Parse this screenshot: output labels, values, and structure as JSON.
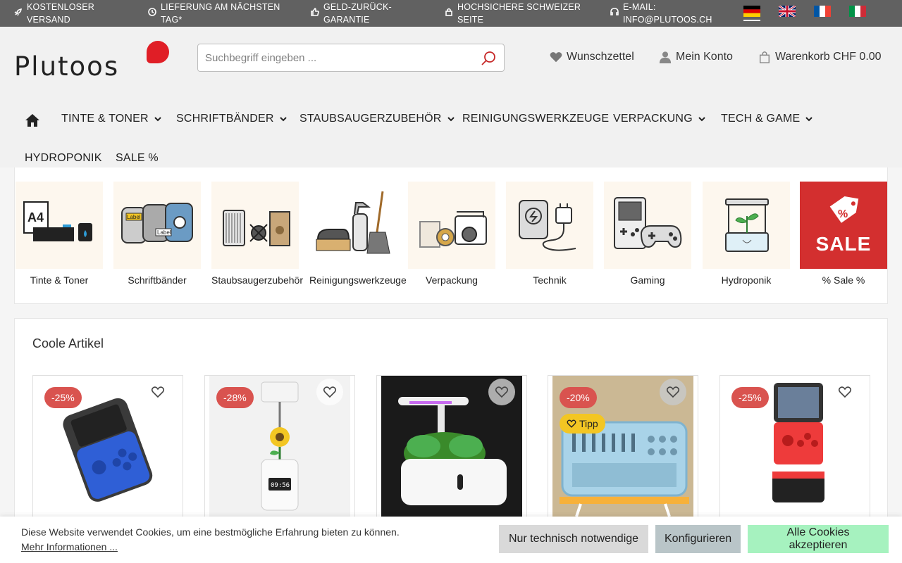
{
  "topbar": {
    "items": [
      {
        "icon": "rocket-icon",
        "line1": "KOSTENLOSER",
        "line2": "VERSAND"
      },
      {
        "icon": "clock-icon",
        "line1": "LIEFERUNG AM NÄCHSTEN",
        "line2": "TAG*"
      },
      {
        "icon": "thumbs-up-icon",
        "line1": "GELD-ZURÜCK-",
        "line2": "GARANTIE"
      },
      {
        "icon": "lock-icon",
        "line1": "HOCHSICHERE SCHWEIZER",
        "line2": "SEITE"
      },
      {
        "icon": "headset-icon",
        "line1": "E-MAIL:",
        "line2": "INFO@PLUTOOS.CH"
      }
    ],
    "languages": [
      "de",
      "en",
      "fr",
      "it"
    ],
    "active_language": "de"
  },
  "header": {
    "logo_text": "Plutoos",
    "search_placeholder": "Suchbegriff eingeben ...",
    "wishlist_label": "Wunschzettel",
    "account_label": "Mein Konto",
    "cart_label": "Warenkorb CHF 0.00"
  },
  "nav": {
    "items": [
      {
        "label": "TINTE & TONER",
        "has_dropdown": true
      },
      {
        "label": "SCHRIFTBÄNDER",
        "has_dropdown": true
      },
      {
        "label": "STAUBSAUGERZUBEHÖR",
        "has_dropdown": true
      },
      {
        "label": "REINIGUNGSWERKZEUGE",
        "has_dropdown": false
      },
      {
        "label": "VERPACKUNG",
        "has_dropdown": true
      },
      {
        "label": "TECH & GAME",
        "has_dropdown": true
      },
      {
        "label": "HYDROPONIK",
        "has_dropdown": false
      },
      {
        "label": "SALE %",
        "has_dropdown": false
      }
    ]
  },
  "categories": [
    {
      "label": "Tinte & Toner"
    },
    {
      "label": "Schriftbänder"
    },
    {
      "label": "Staubsaugerzubehör"
    },
    {
      "label": "Reinigungswerkzeuge"
    },
    {
      "label": "Verpackung"
    },
    {
      "label": "Technik"
    },
    {
      "label": "Gaming"
    },
    {
      "label": "Hydroponik"
    },
    {
      "label": "% Sale %"
    }
  ],
  "sale_tile_text": "SALE",
  "articles": {
    "title": "Coole Artikel",
    "products": [
      {
        "badge": "-25%",
        "tipp": null
      },
      {
        "badge": "-28%",
        "tipp": null
      },
      {
        "badge": null,
        "tipp": null
      },
      {
        "badge": "-20%",
        "tipp": "Tipp"
      },
      {
        "badge": "-25%",
        "tipp": null
      }
    ]
  },
  "cookie": {
    "message": "Diese Website verwendet Cookies, um eine bestmögliche Erfahrung bieten zu können.",
    "more_link": "Mehr Informationen ...",
    "btn_necessary": "Nur technisch notwendige",
    "btn_configure": "Konfigurieren",
    "btn_accept": "Alle Cookies akzeptieren"
  },
  "colors": {
    "topbar_bg": "#616161",
    "brand_red": "#e01e26",
    "badge_red": "#d9534f",
    "tipp_yellow": "#f3c623",
    "accept_green": "#a6f2bf"
  }
}
